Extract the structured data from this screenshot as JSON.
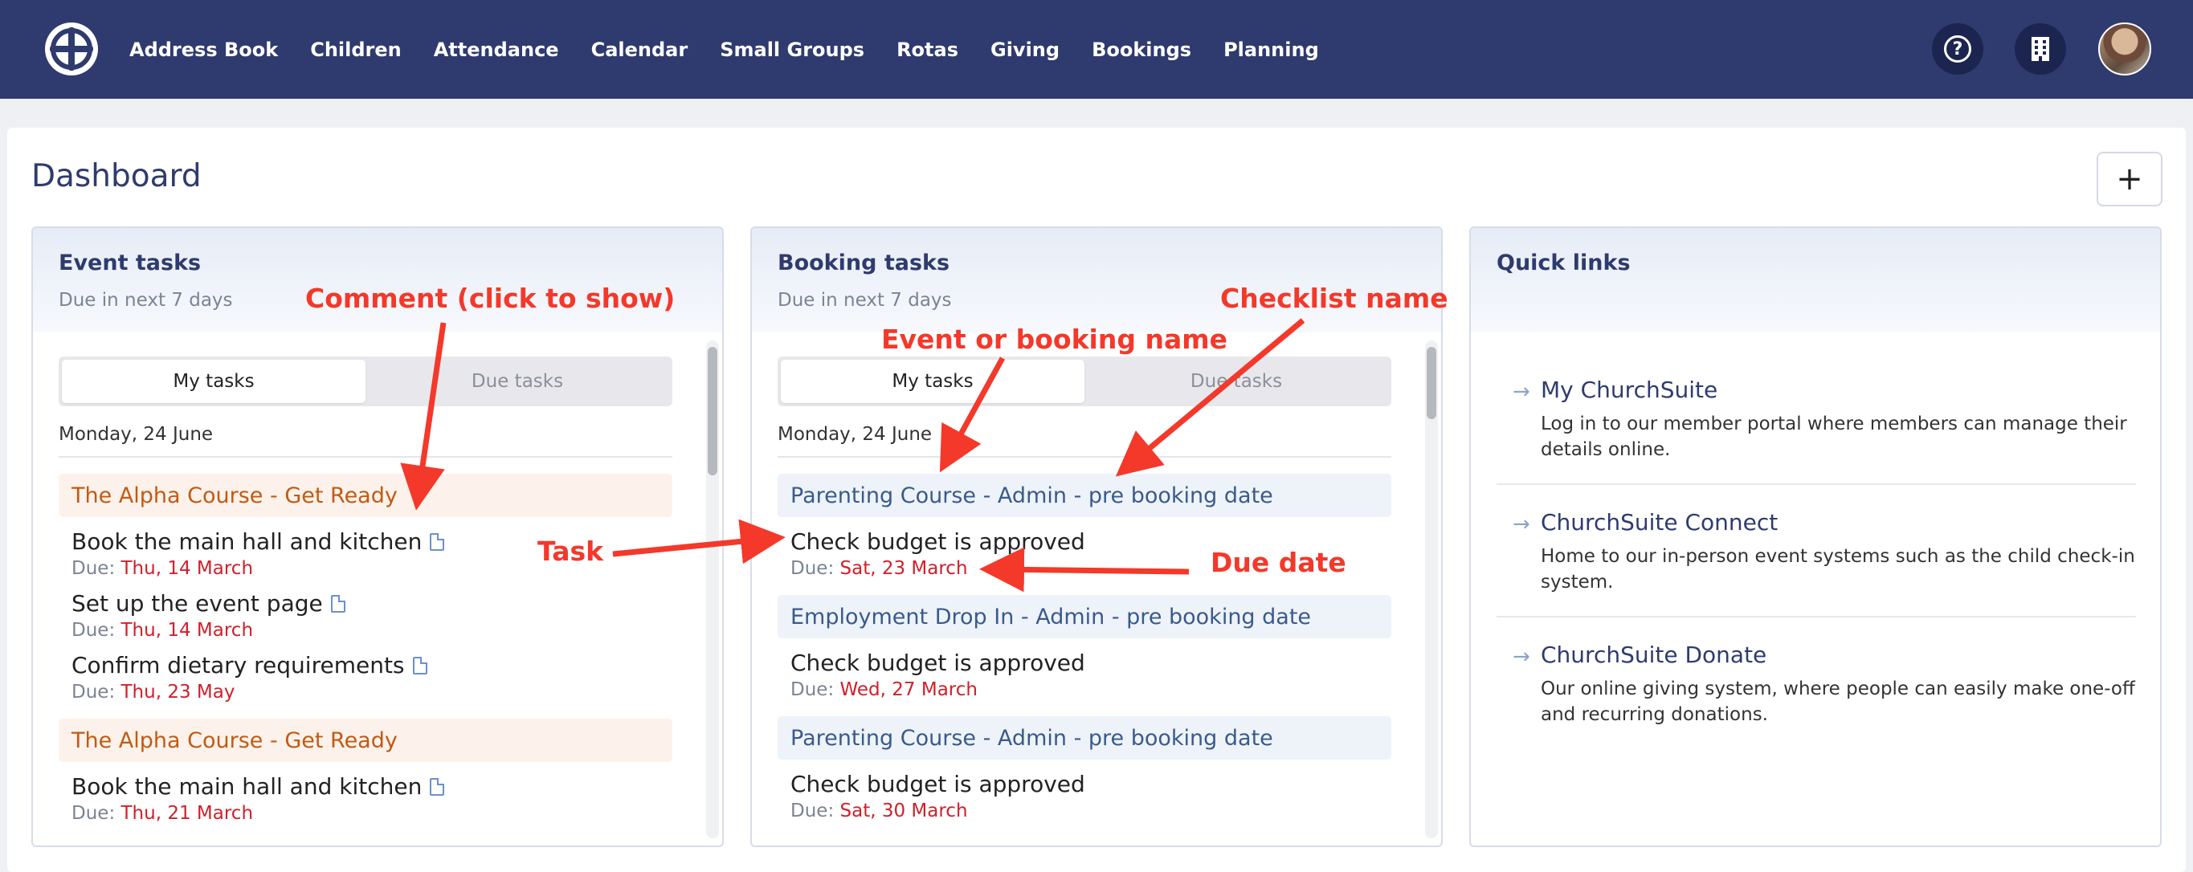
{
  "nav": {
    "items": [
      "Address Book",
      "Children",
      "Attendance",
      "Calendar",
      "Small Groups",
      "Rotas",
      "Giving",
      "Bookings",
      "Planning"
    ],
    "icons": [
      "logo-icon",
      "help-icon",
      "building-icon",
      "avatar"
    ]
  },
  "page": {
    "title": "Dashboard",
    "add_label": "+"
  },
  "event_tasks": {
    "title": "Event tasks",
    "subtitle": "Due in next 7 days",
    "tabs": [
      "My tasks",
      "Due tasks"
    ],
    "active_tab": "My tasks",
    "day": "Monday, 24 June",
    "groups": [
      {
        "name": "The Alpha Course - Get Ready",
        "tasks": [
          {
            "title": "Book the main hall and kitchen",
            "due_label": "Due:",
            "due": "Thu, 14 March"
          },
          {
            "title": "Set up the event page",
            "due_label": "Due:",
            "due": "Thu, 14 March"
          },
          {
            "title": "Confirm dietary requirements",
            "due_label": "Due:",
            "due": "Thu, 23 May"
          }
        ]
      },
      {
        "name": "The Alpha Course - Get Ready",
        "tasks": [
          {
            "title": "Book the main hall and kitchen",
            "due_label": "Due:",
            "due": "Thu, 21 March"
          }
        ]
      }
    ]
  },
  "booking_tasks": {
    "title": "Booking tasks",
    "subtitle": "Due in next 7 days",
    "tabs": [
      "My tasks",
      "Due tasks"
    ],
    "active_tab": "My tasks",
    "day": "Monday, 24 June",
    "groups": [
      {
        "name": "Parenting Course - Admin - pre booking date",
        "tasks": [
          {
            "title": "Check budget is approved",
            "due_label": "Due:",
            "due": "Sat, 23 March"
          }
        ]
      },
      {
        "name": "Employment Drop In - Admin - pre booking date",
        "tasks": [
          {
            "title": "Check budget is approved",
            "due_label": "Due:",
            "due": "Wed, 27 March"
          }
        ]
      },
      {
        "name": "Parenting Course - Admin - pre booking date",
        "tasks": [
          {
            "title": "Check budget is approved",
            "due_label": "Due:",
            "due": "Sat, 30 March"
          }
        ]
      }
    ]
  },
  "quick_links": {
    "title": "Quick links",
    "items": [
      {
        "title": "My ChurchSuite",
        "desc": "Log in to our member portal where members can manage their details online."
      },
      {
        "title": "ChurchSuite Connect",
        "desc": "Home to our in-person event systems such as the child check-in system."
      },
      {
        "title": "ChurchSuite Donate",
        "desc": "Our online giving system, where people can easily make one-off and recurring donations."
      }
    ]
  },
  "annotations": {
    "comment": "Comment (click to show)",
    "event_name": "Event or booking name",
    "checklist": "Checklist name",
    "task": "Task",
    "due_date": "Due date",
    "color": "#f4382a"
  },
  "colors": {
    "nav_bg": "#2f3b6e",
    "due_date": "#d0202a",
    "event_group": "#c25a12",
    "booking_group": "#3a5a8c"
  }
}
